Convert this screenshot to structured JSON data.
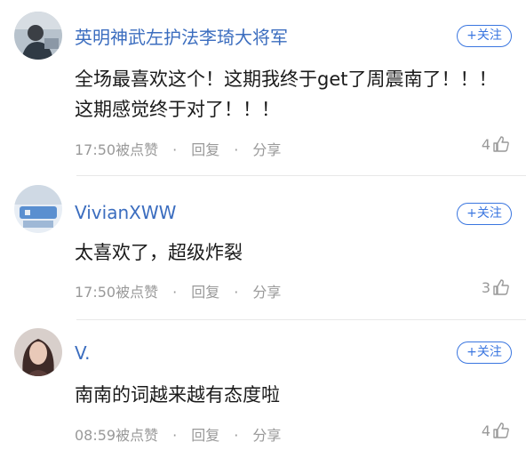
{
  "comments": [
    {
      "username": "英明神武左护法李琦大将军",
      "follow_label": "+关注",
      "text": "全场最喜欢这个！这期我终于get了周震南了！！！这期感觉终于对了！！！",
      "time": "17:50",
      "like_action": "被点赞",
      "separator": "·",
      "reply_label": "回复",
      "share_label": "分享",
      "likes": "4",
      "avatar_colors": [
        "#9aa7b4",
        "#3d4a57"
      ]
    },
    {
      "username": "VivianXWW",
      "follow_label": "+关注",
      "text": "太喜欢了，超级炸裂",
      "time": "17:50",
      "like_action": "被点赞",
      "separator": "·",
      "reply_label": "回复",
      "share_label": "分享",
      "likes": "3",
      "avatar_colors": [
        "#dfe8f2",
        "#4a86c5"
      ]
    },
    {
      "username": "V.",
      "follow_label": "+关注",
      "text": "南南的词越来越有态度啦",
      "time": "08:59",
      "like_action": "被点赞",
      "separator": "·",
      "reply_label": "回复",
      "share_label": "分享",
      "likes": "4",
      "avatar_colors": [
        "#c9b7b0",
        "#4a2f2c"
      ]
    }
  ]
}
